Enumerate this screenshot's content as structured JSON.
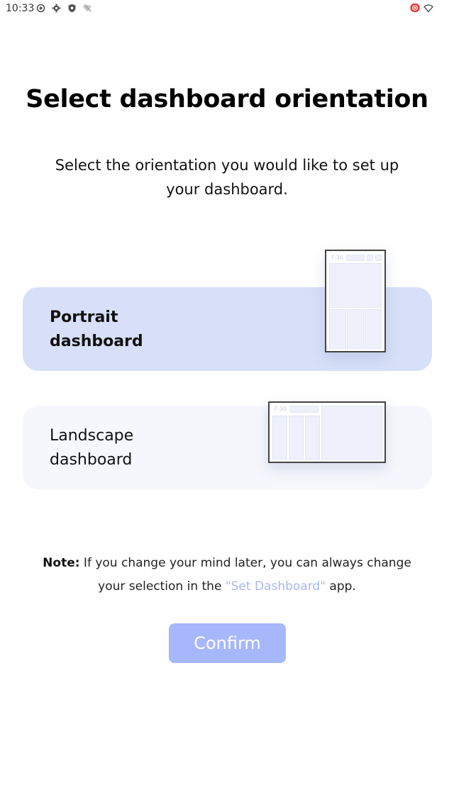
{
  "status_bar": {
    "time": "10:33",
    "left_icons": [
      "record-icon",
      "gear-icon",
      "shield-icon",
      "wifi-off-icon"
    ],
    "right_icons": [
      "record-red-icon",
      "wifi-icon"
    ],
    "accent_red": "#e53935"
  },
  "header": {
    "title": "Select dashboard orientation",
    "subtitle": "Select the orientation you would like to set up your dashboard."
  },
  "options": [
    {
      "label": "Portrait dashboard",
      "selected": true,
      "preview_clock": "7:30",
      "background": "#d7e0f8"
    },
    {
      "label": "Landscape dashboard",
      "selected": false,
      "preview_clock": "7:30",
      "background": "#f5f7fc"
    }
  ],
  "note": {
    "prefix": "Note:",
    "text_before_link": " If you change your mind later, you can always change your selection in the ",
    "link_text": "\"Set Dashboard\"",
    "text_after_link": " app.",
    "link_color": "#a9b7ec"
  },
  "confirm": {
    "label": "Confirm",
    "enabled": false,
    "background": "#a7b7fb"
  }
}
